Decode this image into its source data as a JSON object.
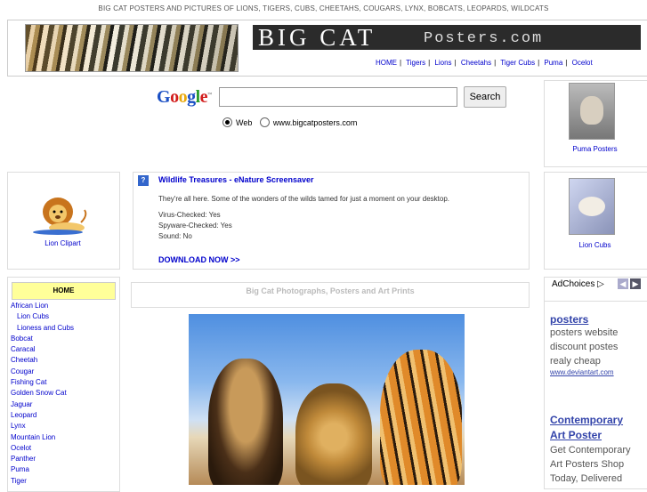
{
  "header": {
    "tagline": "BIG CAT POSTERS AND PICTURES OF LIONS, TIGERS, CUBS, CHEETAHS, COUGARS, LYNX, BOBCATS, LEOPARDS, WILDCATS",
    "logo_big": "BIG CAT",
    "logo_small": "Posters.com"
  },
  "topnav": [
    "HOME",
    "Tigers",
    "Lions",
    "Cheetahs",
    "Tiger Cubs",
    "Puma",
    "Ocelot"
  ],
  "search": {
    "brand": "Google",
    "button": "Search",
    "option_web": "Web",
    "option_site": "www.bigcatposters.com"
  },
  "tiles": {
    "puma": "Puma Posters",
    "lion_clipart": "Lion Clipart",
    "lion_cubs": "Lion Cubs"
  },
  "ad": {
    "icon": "?",
    "title": "Wildlife Treasures - eNature Screensaver",
    "text": "They're all here. Some of the wonders of the wilds tamed for just a moment on your desktop.",
    "spec1": "Virus-Checked: Yes",
    "spec2": "Spyware-Checked: Yes",
    "spec3": "Sound: No",
    "download": "DOWNLOAD NOW >>"
  },
  "sidebar": {
    "home": "HOME",
    "items": [
      {
        "label": "African Lion",
        "sub": false
      },
      {
        "label": "Lion Cubs",
        "sub": true
      },
      {
        "label": "Lioness and Cubs",
        "sub": true
      },
      {
        "label": "Bobcat",
        "sub": false
      },
      {
        "label": "Caracal",
        "sub": false
      },
      {
        "label": "Cheetah",
        "sub": false
      },
      {
        "label": "Cougar",
        "sub": false
      },
      {
        "label": "Fishing Cat",
        "sub": false
      },
      {
        "label": "Golden Snow Cat",
        "sub": false
      },
      {
        "label": "Jaguar",
        "sub": false
      },
      {
        "label": "Leopard",
        "sub": false
      },
      {
        "label": "Lynx",
        "sub": false
      },
      {
        "label": "Mountain Lion",
        "sub": false
      },
      {
        "label": "Ocelot",
        "sub": false
      },
      {
        "label": "Panther",
        "sub": false
      },
      {
        "label": "Puma",
        "sub": false
      },
      {
        "label": "Tiger",
        "sub": false
      }
    ]
  },
  "main": {
    "heading": "Big Cat Photographs, Posters and Art Prints"
  },
  "right_ads": {
    "adchoices": "AdChoices",
    "ad1": {
      "title": "posters",
      "l1": "posters website",
      "l2": "discount postes",
      "l3": "realy cheap",
      "url": "www.deviantart.com"
    },
    "ad2": {
      "title1": "Contemporary",
      "title2": "Art Poster",
      "l1": "Get Contemporary",
      "l2": "Art Posters Shop",
      "l3": "Today, Delivered"
    }
  },
  "colors": {
    "link": "#0000cc",
    "home_bg": "#ffff99",
    "logo_bg": "#2b2b2b"
  }
}
